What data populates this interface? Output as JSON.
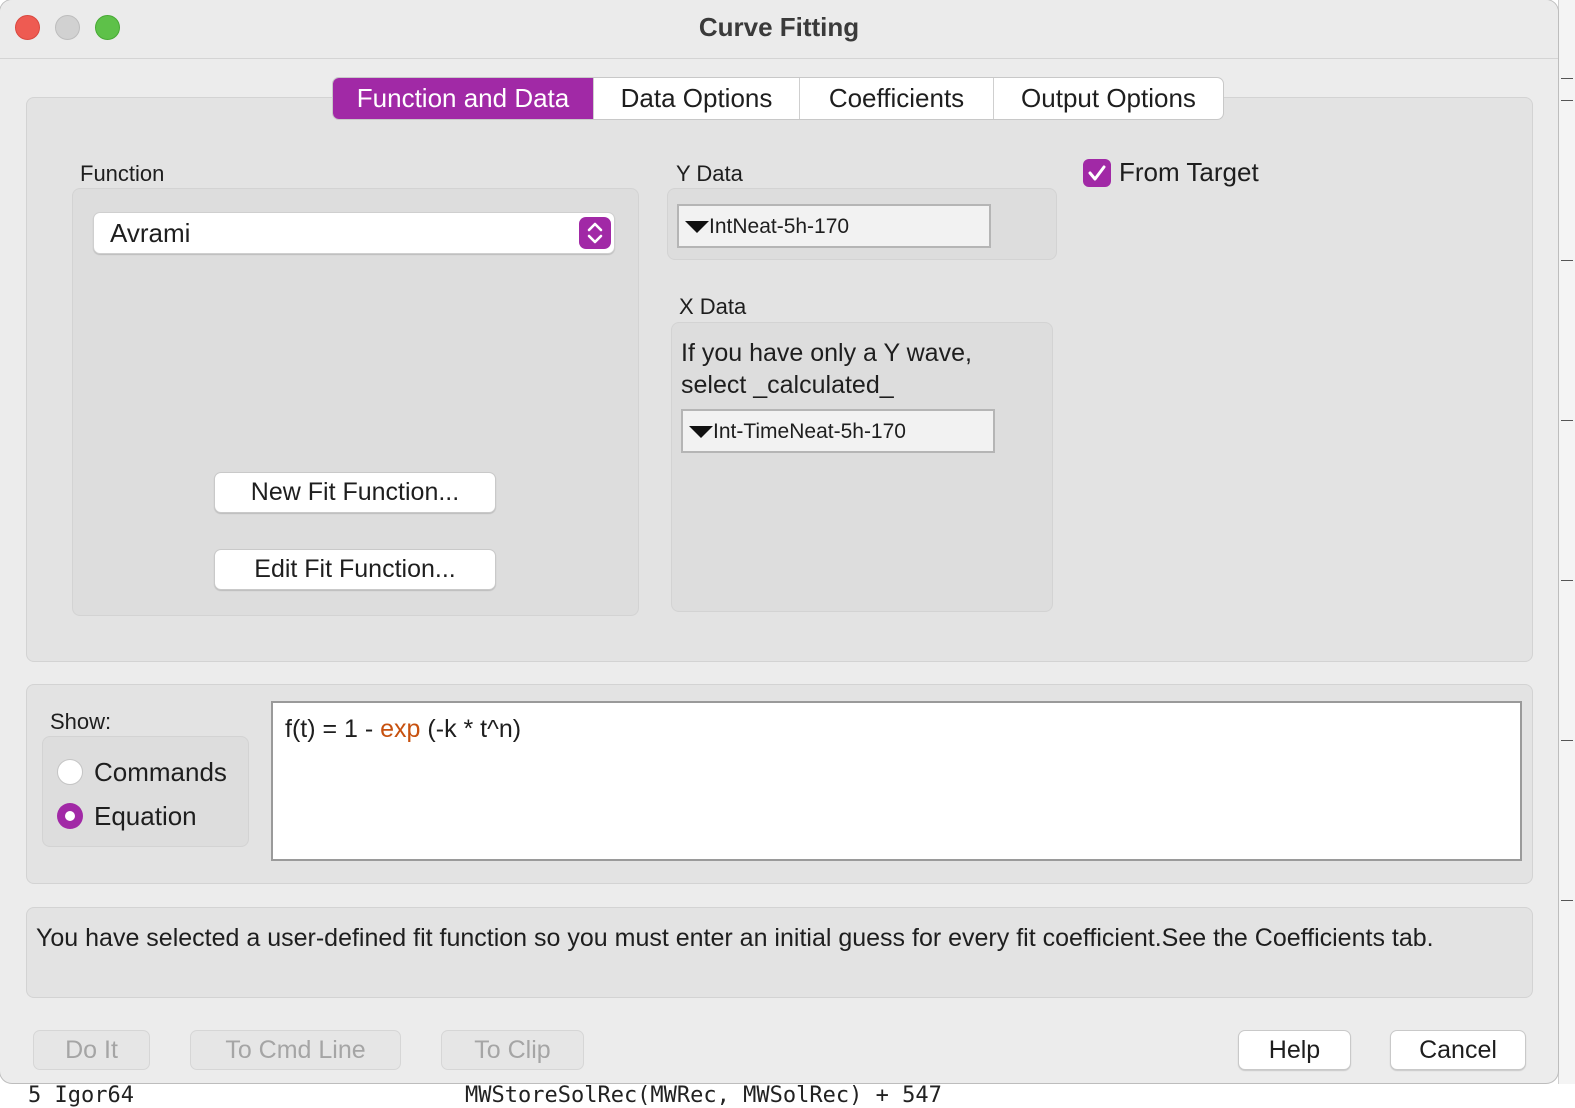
{
  "window": {
    "title": "Curve Fitting"
  },
  "tabs": [
    "Function and Data",
    "Data Options",
    "Coefficients",
    "Output Options"
  ],
  "function_section": {
    "label": "Function",
    "selected": "Avrami",
    "new_button": "New Fit Function...",
    "edit_button": "Edit Fit Function..."
  },
  "y_data": {
    "label": "Y Data",
    "selected": "IntNeat-5h-170"
  },
  "from_target": {
    "label": "From Target",
    "checked": true
  },
  "x_data": {
    "label": "X Data",
    "hint_line1": "If you have only a Y wave,",
    "hint_line2": "select _calculated_",
    "selected": "Int-TimeNeat-5h-170"
  },
  "show": {
    "label": "Show:",
    "options": [
      "Commands",
      "Equation"
    ],
    "selected": "Equation"
  },
  "equation": {
    "prefix": "f(t) = 1 - ",
    "function_name": "exp",
    "suffix": " (-k * t^n)",
    "function_color": "#c7510f"
  },
  "message": "You have selected a user-defined fit function so you must enter an initial guess for every fit coefficient.See the Coefficients tab.",
  "buttons": {
    "do_it": "Do It",
    "to_cmd_line": "To Cmd Line",
    "to_clip": "To Clip",
    "help": "Help",
    "cancel": "Cancel"
  },
  "background": {
    "left_text": "5 Igor64",
    "mid_text": "MWStoreSolRec(MWRec, MWSolRec) + 547"
  },
  "colors": {
    "accent": "#a129a6",
    "window_bg": "#ececec",
    "panel_bg": "#e3e3e3"
  }
}
